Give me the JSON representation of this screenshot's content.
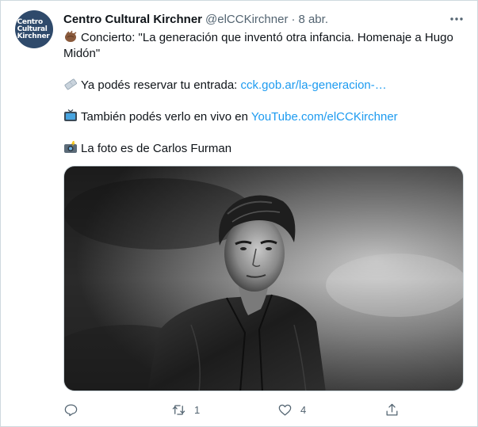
{
  "tweet": {
    "author_name": "Centro Cultural Kirchner",
    "handle": "@elCCKirchner",
    "separator": "·",
    "date": "8 abr.",
    "avatar_text": "Centro\nCultural\nKirchner",
    "more_icon": "more-dots-icon",
    "lines": {
      "concert_text": "Concierto: \"La generación que inventó otra infancia. Homenaje a Hugo Midón\"",
      "ticket_text": "Ya podés reservar tu entrada: ",
      "ticket_link": "cck.gob.ar/la-generacion-…",
      "live_text": "También podés verlo en vivo en ",
      "live_link": "YouTube.com/elCCKirchner",
      "photo_text": "La foto es de Carlos Furman"
    },
    "actions": {
      "reply_count": "",
      "retweet_count": "1",
      "like_count": "4"
    }
  },
  "colors": {
    "link": "#1d9bf0",
    "muted": "#536471",
    "text": "#0f1419",
    "avatar_bg": "#2f4a6b"
  }
}
